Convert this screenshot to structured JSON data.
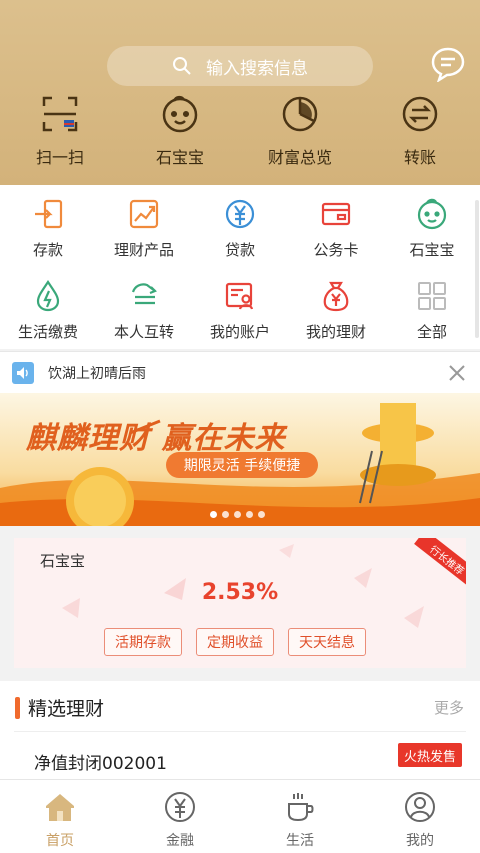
{
  "search": {
    "placeholder": "输入搜索信息"
  },
  "top_actions": [
    {
      "label": "扫一扫",
      "icon": "scan-icon"
    },
    {
      "label": "石宝宝",
      "icon": "baby-face-icon"
    },
    {
      "label": "财富总览",
      "icon": "pie-chart-icon"
    },
    {
      "label": "转账",
      "icon": "transfer-icon"
    }
  ],
  "grid": [
    {
      "label": "存款",
      "icon": "deposit-icon"
    },
    {
      "label": "理财产品",
      "icon": "finance-product-icon"
    },
    {
      "label": "贷款",
      "icon": "loan-icon"
    },
    {
      "label": "公务卡",
      "icon": "card-icon"
    },
    {
      "label": "石宝宝",
      "icon": "baby-face-icon"
    },
    {
      "label": "生活缴费",
      "icon": "utility-drop-icon"
    },
    {
      "label": "本人互转",
      "icon": "self-transfer-icon"
    },
    {
      "label": "我的账户",
      "icon": "account-icon"
    },
    {
      "label": "我的理财",
      "icon": "money-bag-icon"
    },
    {
      "label": "全部",
      "icon": "all-apps-icon"
    }
  ],
  "notice": {
    "text": "饮湖上初晴后雨"
  },
  "banner": {
    "title": "麒麟理财 赢在未来",
    "tagline": "期限灵活  手续便捷",
    "slides": 5,
    "active_slide": 1
  },
  "product_card": {
    "name": "石宝宝",
    "rate": "2.53%",
    "ribbon": "行长推荐",
    "chips": [
      "活期存款",
      "定期收益",
      "天天结息"
    ]
  },
  "featured": {
    "title": "精选理财",
    "more": "更多",
    "product_name": "净值封闭002001",
    "badge": "火热发售"
  },
  "tabbar": [
    {
      "label": "首页",
      "icon": "home-icon",
      "active": true
    },
    {
      "label": "金融",
      "icon": "yen-circle-icon",
      "active": false
    },
    {
      "label": "生活",
      "icon": "coffee-icon",
      "active": false
    },
    {
      "label": "我的",
      "icon": "user-icon",
      "active": false
    }
  ],
  "colors": {
    "header": "#d3b27a",
    "accent": "#f06a2d",
    "rate": "#e8432d",
    "tab_active": "#c9a066"
  }
}
